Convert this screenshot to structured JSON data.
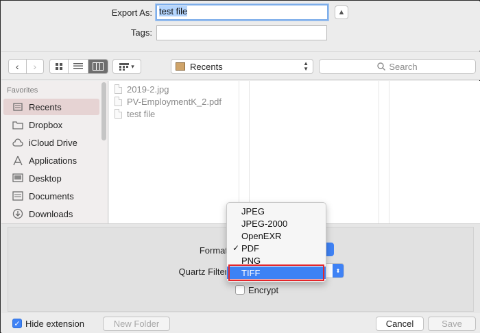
{
  "export_as": {
    "label": "Export As:",
    "value": "test file"
  },
  "tags": {
    "label": "Tags:",
    "value": ""
  },
  "expand_icon": "chevron-up-icon",
  "toolbar": {
    "back_icon": "chevron-left-icon",
    "forward_icon": "chevron-right-icon",
    "view_icons": [
      "grid-icon",
      "list-icon",
      "columns-icon"
    ],
    "group_icon": "group-icon",
    "location": "Recents",
    "search_placeholder": "Search"
  },
  "sidebar": {
    "heading": "Favorites",
    "items": [
      {
        "label": "Recents",
        "icon": "recents-icon",
        "selected": true
      },
      {
        "label": "Dropbox",
        "icon": "folder-icon"
      },
      {
        "label": "iCloud Drive",
        "icon": "cloud-icon"
      },
      {
        "label": "Applications",
        "icon": "applications-icon"
      },
      {
        "label": "Desktop",
        "icon": "desktop-icon"
      },
      {
        "label": "Documents",
        "icon": "documents-icon"
      },
      {
        "label": "Downloads",
        "icon": "downloads-icon"
      }
    ]
  },
  "files": [
    "2019-2.jpg",
    "PV-EmploymentK_2.pdf",
    "test file"
  ],
  "options": {
    "format_label": "Format",
    "quartz_label": "Quartz Filter",
    "encrypt_label": "Encrypt",
    "encrypt_checked": false
  },
  "format_menu": {
    "items": [
      {
        "label": "JPEG"
      },
      {
        "label": "JPEG-2000"
      },
      {
        "label": "OpenEXR"
      },
      {
        "label": "PDF",
        "checked": true,
        "check": "✓"
      },
      {
        "label": "PNG"
      },
      {
        "label": "TIFF",
        "highlighted": true
      }
    ]
  },
  "bottom": {
    "hide_extension": "Hide extension",
    "hide_extension_checked": true,
    "new_folder": "New Folder",
    "cancel": "Cancel",
    "save": "Save"
  },
  "colors": {
    "accent": "#3d82f4",
    "highlight_box": "#e3262b",
    "sidebar_selected": "#e6d3d3"
  }
}
